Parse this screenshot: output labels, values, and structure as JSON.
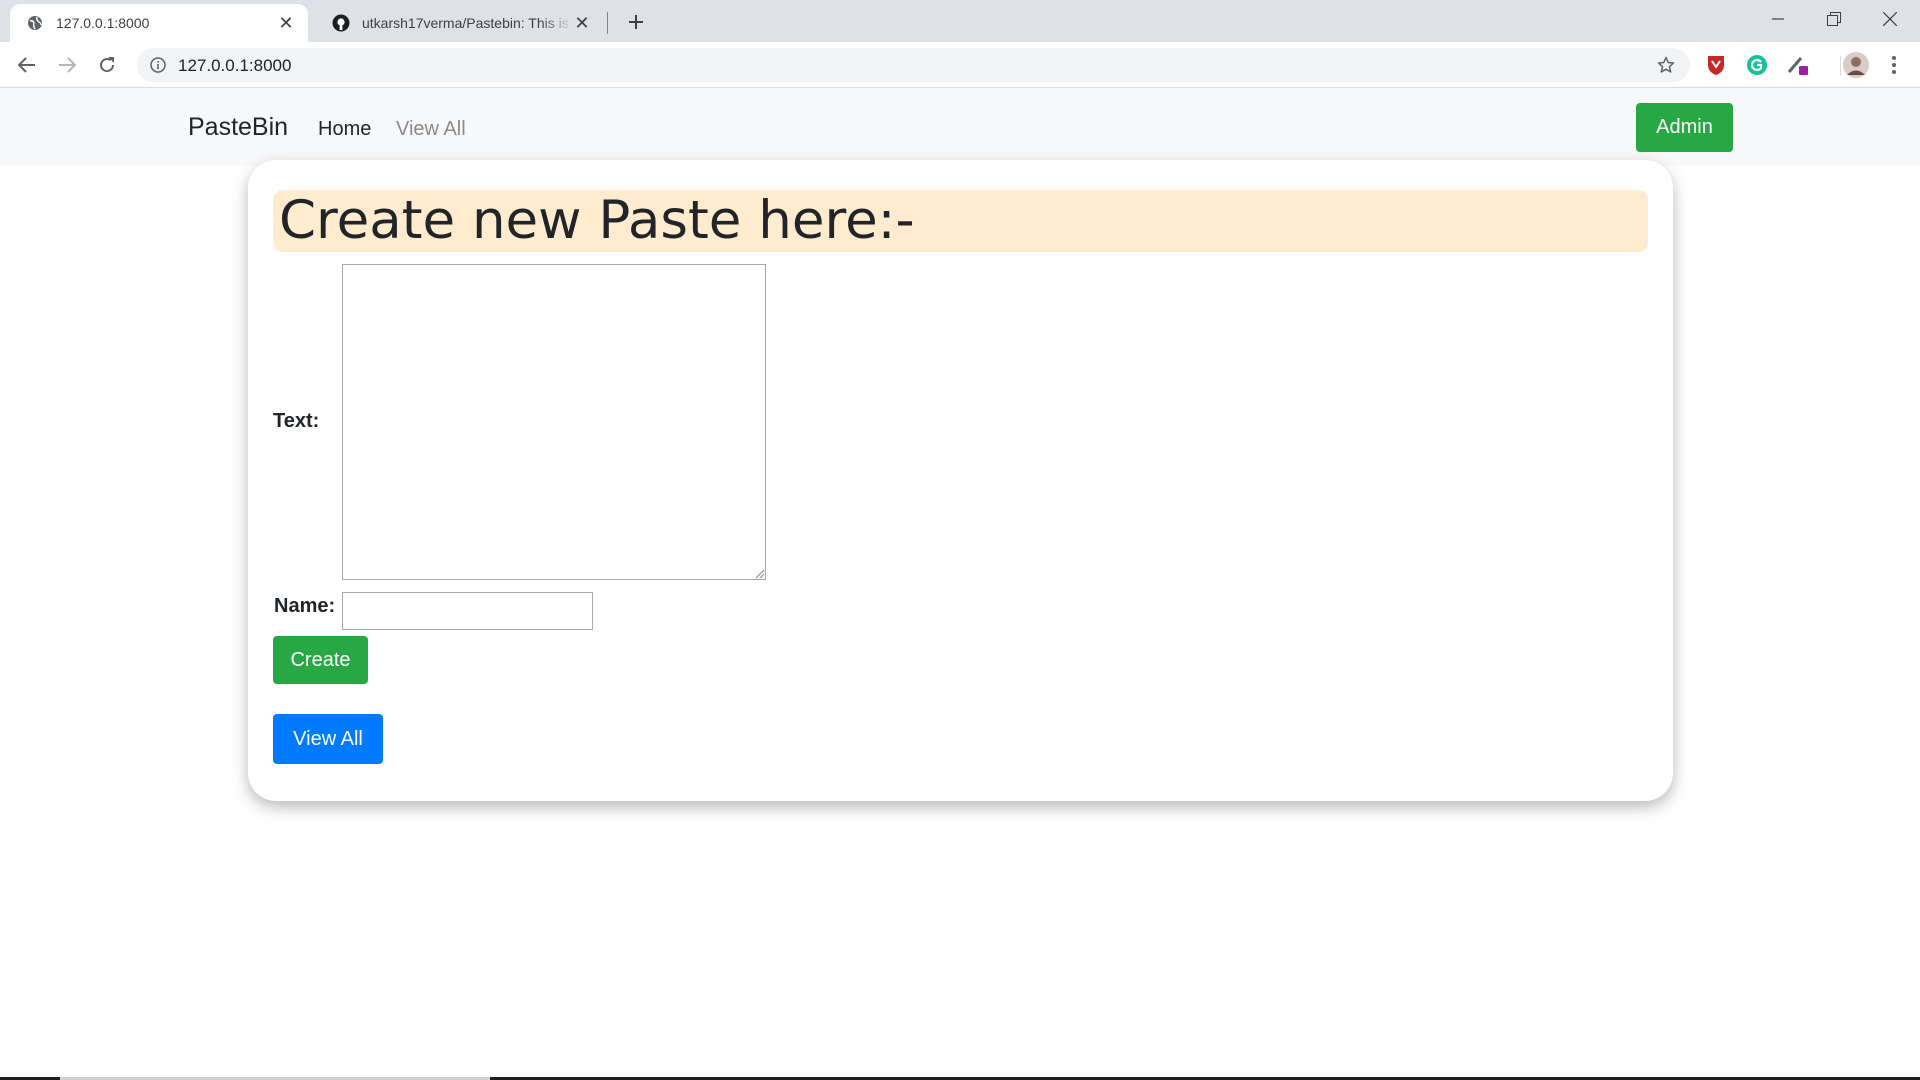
{
  "browser": {
    "tabs": [
      {
        "title": "127.0.0.1:8000",
        "icon": "globe-icon",
        "active": true
      },
      {
        "title": "utkarsh17verma/Pastebin: This is",
        "icon": "github-icon",
        "active": false
      }
    ],
    "address": "127.0.0.1:8000"
  },
  "nav": {
    "brand": "PasteBin",
    "links": [
      "Home",
      "View All"
    ],
    "admin_label": "Admin"
  },
  "form": {
    "heading": "Create new Paste here:-",
    "text_label": "Text:",
    "text_value": "",
    "name_label": "Name:",
    "name_value": "",
    "create_label": "Create",
    "view_all_label": "View All"
  },
  "colors": {
    "success": "#28a745",
    "primary": "#007bff",
    "heading_bg": "#ffebcd",
    "navbar_bg": "#f8f9fa"
  }
}
